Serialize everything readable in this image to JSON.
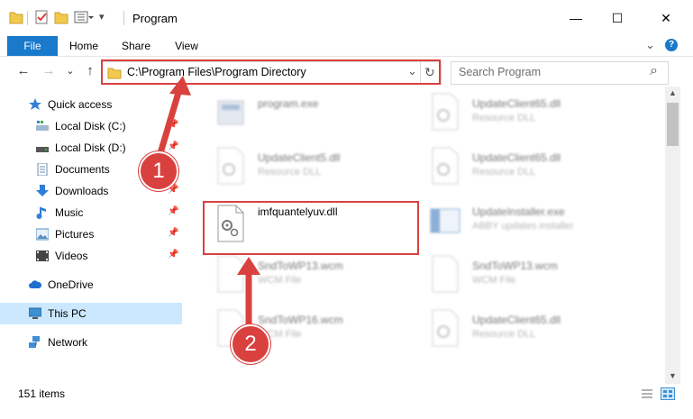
{
  "window": {
    "title": "Program",
    "minimize_glyph": "—",
    "maximize_glyph": "☐",
    "close_glyph": "✕"
  },
  "ribbon": {
    "tabs": [
      "File",
      "Home",
      "Share",
      "View"
    ],
    "expand_glyph": "⌄",
    "help_glyph": "?"
  },
  "address": {
    "path": "C:\\Program Files\\Program Directory",
    "dropdown_glyph": "⌄",
    "refresh_glyph": "↻"
  },
  "search": {
    "placeholder": "Search Program",
    "icon_glyph": "⌕"
  },
  "nav_arrows": {
    "back": "←",
    "forward": "→",
    "recent": "⌄",
    "up": "↑"
  },
  "navpane": {
    "pin_glyph": "📌",
    "items": [
      {
        "label": "Quick access",
        "icon": "star-icon",
        "color": "#2f7fd8"
      },
      {
        "label": "Local Disk (C:)",
        "icon": "drive-icon",
        "color": "#5a8fbf"
      },
      {
        "label": "Local Disk (D:)",
        "icon": "drive-icon",
        "color": "#555555"
      },
      {
        "label": "Documents",
        "icon": "documents-icon",
        "color": "#6c8fb0"
      },
      {
        "label": "Downloads",
        "icon": "downloads-icon",
        "color": "#2f7fd8"
      },
      {
        "label": "Music",
        "icon": "music-icon",
        "color": "#2f7fd8"
      },
      {
        "label": "Pictures",
        "icon": "pictures-icon",
        "color": "#5a8fbf"
      },
      {
        "label": "Videos",
        "icon": "videos-icon",
        "color": "#444444"
      },
      {
        "label": "OneDrive",
        "icon": "cloud-icon",
        "color": "#1e6fcf"
      },
      {
        "label": "This PC",
        "icon": "computer-icon",
        "color": "#3f8fd4"
      },
      {
        "label": "Network",
        "icon": "network-icon",
        "color": "#3f8fd4"
      }
    ]
  },
  "files": [
    {
      "name": "program.exe",
      "type": ""
    },
    {
      "name": "UpdateClient65.dll",
      "type": "Resource DLL"
    },
    {
      "name": "UpdateClient5.dll",
      "type": "Resource DLL"
    },
    {
      "name": "UpdateClient65.dll",
      "type": "Resource DLL"
    },
    {
      "name": "imfquantelyuv.dll",
      "type": ""
    },
    {
      "name": "UpdateInstaller.exe",
      "type": "ABBY updates installer"
    },
    {
      "name": "SndToWP13.wcm",
      "type": "WCM File"
    },
    {
      "name": "SndToWP13.wcm",
      "type": "WCM File"
    },
    {
      "name": "SndToWP16.wcm",
      "type": "WCM File"
    },
    {
      "name": "UpdateClient65.dll",
      "type": "Resource DLL"
    }
  ],
  "status": {
    "item_count": "151 items"
  },
  "annotations": {
    "step1": "1",
    "step2": "2",
    "accent_color": "#d9413f"
  },
  "colors": {
    "file_tab": "#1979ca",
    "selected_nav": "#cce8ff"
  }
}
